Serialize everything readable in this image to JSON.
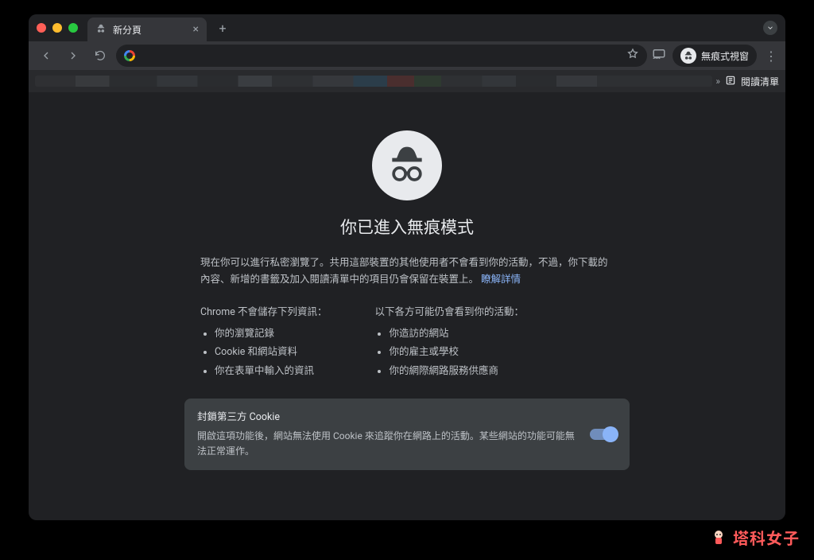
{
  "tab": {
    "title": "新分頁"
  },
  "toolbar": {
    "address_value": "",
    "incognito_label": "無痕式視窗"
  },
  "bookmarks": {
    "reading_list_label": "閱讀清單"
  },
  "page": {
    "heading": "你已進入無痕模式",
    "paragraph_a": "現在你可以進行私密瀏覽了。共用這部裝置的其他使用者不會看到你的活動，不過，你下載的內容、新增的書籤及加入閱讀清單中的項目仍會保留在裝置上。",
    "learn_more": "瞭解詳情",
    "col_left_title": "Chrome 不會儲存下列資訊：",
    "col_left_items": [
      "你的瀏覽記錄",
      "Cookie 和網站資料",
      "你在表單中輸入的資訊"
    ],
    "col_right_title": "以下各方可能仍會看到你的活動：",
    "col_right_items": [
      "你造訪的網站",
      "你的雇主或學校",
      "你的網際網路服務供應商"
    ],
    "cookie_title": "封鎖第三方 Cookie",
    "cookie_desc": "開啟這項功能後，網站無法使用 Cookie 來追蹤你在網路上的活動。某些網站的功能可能無法正常運作。"
  },
  "watermark": {
    "text": "塔科女子"
  }
}
